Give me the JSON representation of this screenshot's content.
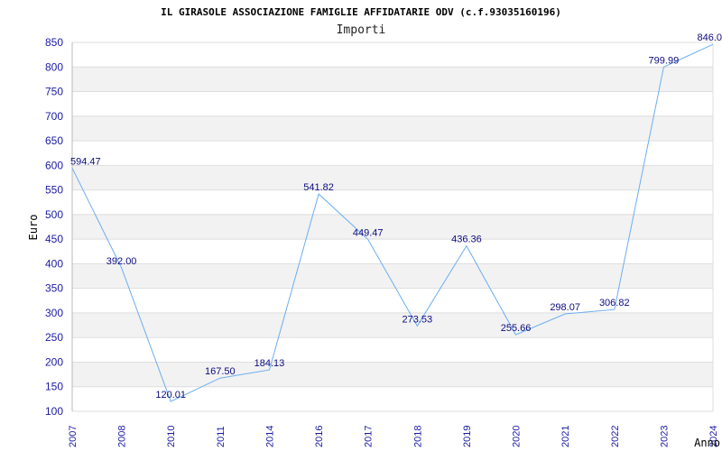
{
  "chart_data": {
    "type": "line",
    "title": "IL GIRASOLE ASSOCIAZIONE FAMIGLIE AFFIDATARIE ODV (c.f.93035160196)",
    "subtitle": "Importi",
    "xlabel": "Anno",
    "ylabel": "Euro",
    "categories": [
      "2007",
      "2008",
      "2010",
      "2011",
      "2014",
      "2016",
      "2017",
      "2018",
      "2019",
      "2020",
      "2021",
      "2022",
      "2023",
      "2024"
    ],
    "values": [
      594.47,
      392.0,
      120.01,
      167.5,
      184.13,
      541.82,
      449.47,
      273.53,
      436.36,
      255.66,
      298.07,
      306.82,
      799.99,
      846.0
    ],
    "data_labels": [
      "594.47",
      "392.00",
      "120.01",
      "167.50",
      "184.13",
      "541.82",
      "449.47",
      "273.53",
      "436.36",
      "255.66",
      "298.07",
      "306.82",
      "799.99",
      "846.0"
    ],
    "ylim": [
      100,
      850
    ],
    "yticks": [
      100,
      150,
      200,
      250,
      300,
      350,
      400,
      450,
      500,
      550,
      600,
      650,
      700,
      750,
      800,
      850
    ],
    "grid": true,
    "colors": {
      "line": "#6aaef0",
      "band": "#f2f2f2",
      "grid": "#dddddd",
      "tick_text": "#1a1aa6",
      "label_text": "#0c0c80"
    }
  }
}
